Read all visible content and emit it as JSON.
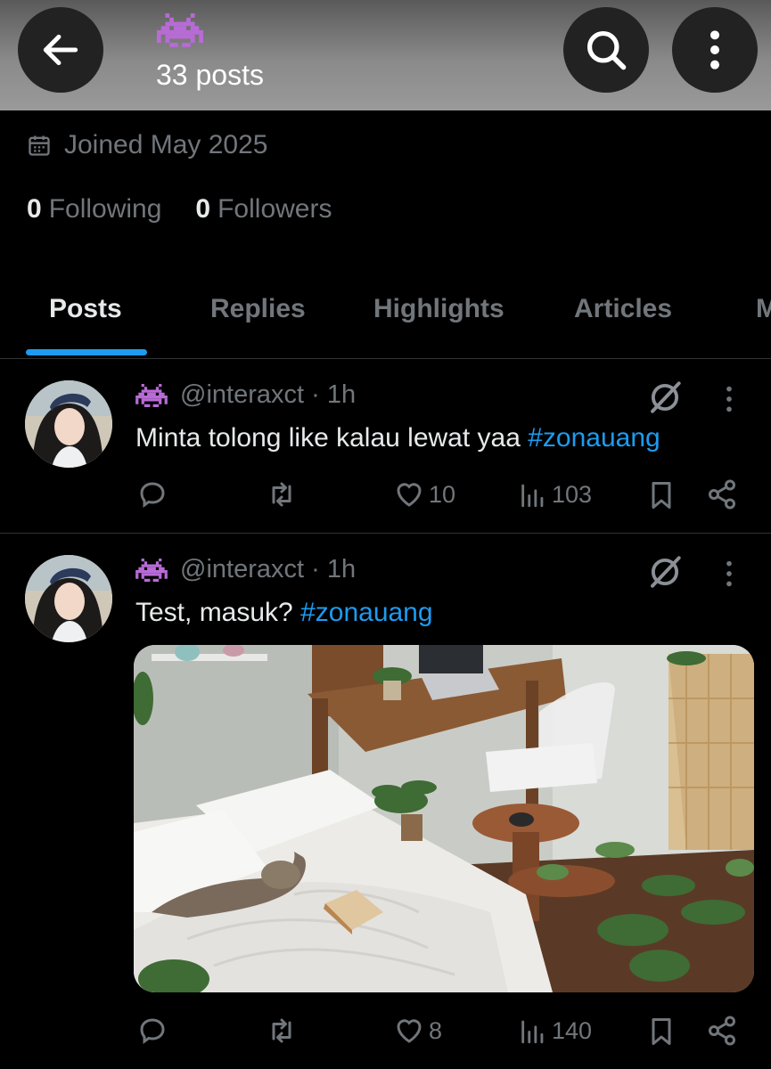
{
  "header": {
    "posts_count": "33 posts"
  },
  "profile": {
    "joined": "Joined May 2025",
    "following_count": "0",
    "following_label": "Following",
    "followers_count": "0",
    "followers_label": "Followers"
  },
  "tabs": [
    {
      "label": "Posts",
      "active": true
    },
    {
      "label": "Replies",
      "active": false
    },
    {
      "label": "Highlights",
      "active": false
    },
    {
      "label": "Articles",
      "active": false
    },
    {
      "label": "M",
      "active": false
    }
  ],
  "posts": [
    {
      "handle": "@interaxct",
      "time": "1h",
      "text": "Minta tolong like kalau lewat yaa ",
      "hashtag": "#zonauang",
      "likes": "10",
      "views": "103",
      "has_image": false
    },
    {
      "handle": "@interaxct",
      "time": "1h",
      "text": "Test, masuk? ",
      "hashtag": "#zonauang",
      "likes": "8",
      "views": "140",
      "has_image": true
    }
  ],
  "icons": {
    "back": "arrow-left-icon",
    "search": "search-icon",
    "more": "more-vertical-icon",
    "calendar": "calendar-icon",
    "reply": "reply-icon",
    "repost": "repost-icon",
    "like": "heart-icon",
    "views": "views-icon",
    "bookmark": "bookmark-icon",
    "share": "share-icon",
    "grok": "grok-icon"
  },
  "colors": {
    "accent": "#1d9bf0",
    "muted": "#71767b",
    "invader": "#b86bd6"
  }
}
